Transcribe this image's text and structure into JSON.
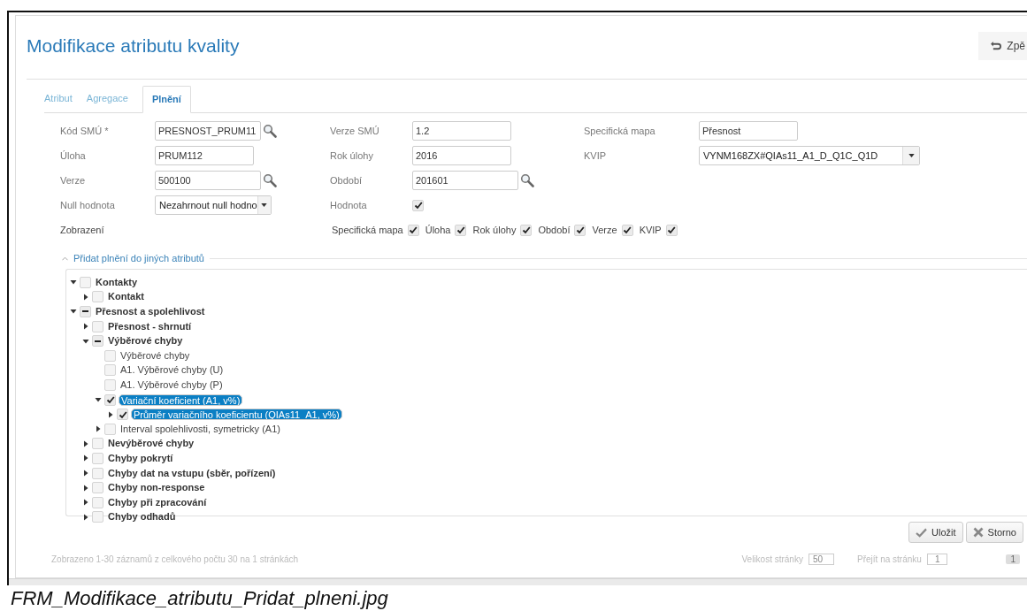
{
  "page": {
    "title": "Modifikace atributu kvality",
    "back_button": "Zpě"
  },
  "tabs": [
    {
      "label": "Atribut",
      "selected": false
    },
    {
      "label": "Agregace",
      "selected": false
    },
    {
      "label": "Plnění",
      "selected": true
    }
  ],
  "form": {
    "rows": [
      [
        {
          "label": "Kód SMÚ *",
          "kind": "lookup",
          "value": "PRESNOST_PRUM11"
        },
        {
          "label": "Verze SMÚ",
          "kind": "text",
          "value": "1.2"
        },
        {
          "label": "Specifická mapa",
          "kind": "text",
          "value": "Přesnost"
        }
      ],
      [
        {
          "label": "Úloha",
          "kind": "text",
          "value": "PRUM112"
        },
        {
          "label": "Rok úlohy",
          "kind": "text",
          "value": "2016"
        },
        {
          "label": "KVIP",
          "kind": "wide-select",
          "value": "VYNM168ZX#QIAs11_A1_D_Q1C_Q1D"
        }
      ],
      [
        {
          "label": "Verze",
          "kind": "lookup",
          "value": "500100"
        },
        {
          "label": "Období",
          "kind": "lookup",
          "value": "201601"
        }
      ],
      [
        {
          "label": "Null hodnota",
          "kind": "select",
          "value": "Nezahrnout null hodno"
        },
        {
          "label": "Hodnota",
          "kind": "checkbox",
          "checked": true
        }
      ]
    ],
    "display": {
      "label": "Zobrazení",
      "options": [
        {
          "label": "Specifická mapa",
          "checked": true
        },
        {
          "label": "Úloha",
          "checked": true
        },
        {
          "label": "Rok úlohy",
          "checked": true
        },
        {
          "label": "Období",
          "checked": true
        },
        {
          "label": "Verze",
          "checked": true
        },
        {
          "label": "KVIP",
          "checked": true
        }
      ]
    }
  },
  "section": {
    "title": "Přidat plnění do jiných atributů",
    "expanded": true
  },
  "tree": [
    {
      "label": "Kontakty",
      "kind": "category",
      "expanded": true,
      "checked": false,
      "partial": false,
      "selected": false,
      "children": [
        {
          "label": "Kontakt",
          "kind": "category",
          "expanded": false,
          "checked": false,
          "partial": false,
          "selected": false
        }
      ]
    },
    {
      "label": "Přesnost a spolehlivost",
      "kind": "category",
      "expanded": true,
      "checked": false,
      "partial": true,
      "selected": false,
      "children": [
        {
          "label": "Přesnost - shrnutí",
          "kind": "category",
          "expanded": false,
          "checked": false,
          "partial": false,
          "selected": false
        },
        {
          "label": "Výběrové chyby",
          "kind": "category",
          "expanded": true,
          "checked": false,
          "partial": true,
          "selected": false,
          "children": [
            {
              "label": "Výběrové chyby",
              "kind": "attribute",
              "checked": false,
              "partial": false,
              "selected": false
            },
            {
              "label": "A1. Výběrové chyby (U)",
              "kind": "attribute",
              "checked": false,
              "partial": false,
              "selected": false
            },
            {
              "label": "A1. Výběrové chyby (P)",
              "kind": "attribute",
              "checked": false,
              "partial": false,
              "selected": false
            },
            {
              "label": "Variační koeficient (A1, v%)",
              "kind": "attribute",
              "expanded": true,
              "checked": true,
              "selected": true,
              "children": [
                {
                  "label": "Průměr variačního koeficientu (QIAs11_A1, v%)",
                  "kind": "attribute",
                  "expanded": false,
                  "checked": true,
                  "selected": true
                }
              ]
            },
            {
              "label": "Interval spolehlivosti, symetricky (A1)",
              "kind": "attribute",
              "expanded": false,
              "checked": false,
              "partial": false,
              "selected": false
            }
          ]
        },
        {
          "label": "Nevýběrové chyby",
          "kind": "category",
          "expanded": false,
          "checked": false,
          "partial": false,
          "selected": false
        },
        {
          "label": "Chyby pokrytí",
          "kind": "category",
          "expanded": false,
          "checked": false,
          "partial": false,
          "selected": false
        },
        {
          "label": "Chyby dat na vstupu (sběr, pořízení)",
          "kind": "category",
          "expanded": false,
          "checked": false,
          "partial": false,
          "selected": false
        },
        {
          "label": "Chyby non-response",
          "kind": "category",
          "expanded": false,
          "checked": false,
          "partial": false,
          "selected": false
        },
        {
          "label": "Chyby při zpracování",
          "kind": "category",
          "expanded": false,
          "checked": false,
          "partial": false,
          "selected": false
        },
        {
          "label": "Chyby odhadů",
          "kind": "category",
          "expanded": false,
          "checked": false,
          "partial": false,
          "selected": false
        }
      ]
    }
  ],
  "actions": [
    "Uložit",
    "Storno"
  ],
  "pager": {
    "summary": "Zobrazeno 1-30 záznamů z celkového počtu 30 na 1 stránkách",
    "page_size_label": "Velikost stránky",
    "page_size": "50",
    "goto_label": "Přejít na stránku",
    "goto_value": "1",
    "current_page": "1"
  },
  "caption": "FRM_Modifikace_atributu_Pridat_plneni.jpg"
}
